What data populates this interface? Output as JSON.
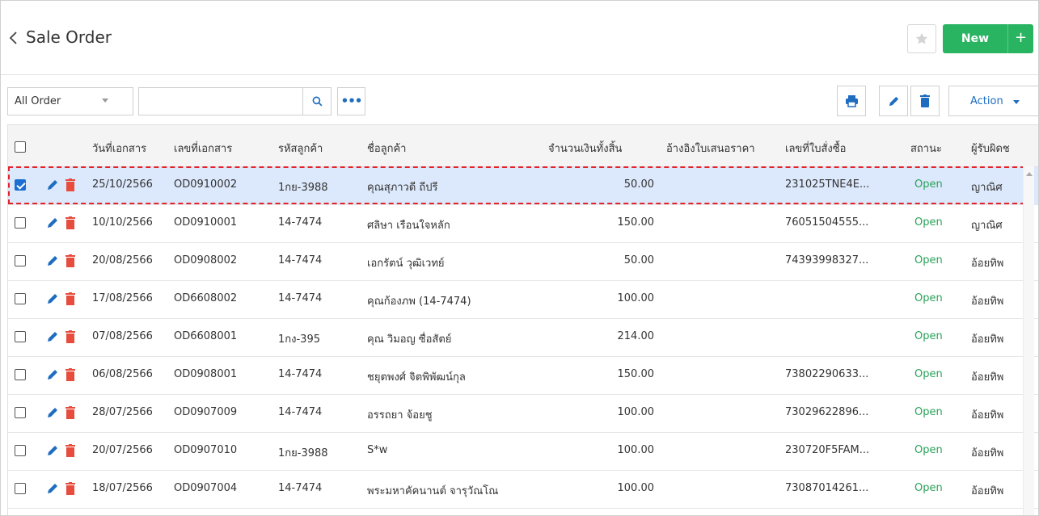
{
  "header": {
    "title": "Sale Order",
    "new_label": "New",
    "plus_label": "+"
  },
  "toolbar": {
    "filter_value": "All Order",
    "search_placeholder": "",
    "more_label": "•••",
    "action_label": "Action"
  },
  "colors": {
    "accent_green": "#29b461",
    "accent_blue": "#1e6dc0",
    "delete_red": "#e74c3c",
    "status_green": "#2aa35a",
    "highlight_red": "#e1242b",
    "selected_row": "#dce8fb"
  },
  "table": {
    "columns": [
      "วันที่เอกสาร",
      "เลขที่เอกสาร",
      "รหัสลูกค้า",
      "ชื่อลูกค้า",
      "จำนวนเงินทั้งสิ้น",
      "อ้างอิงใบเสนอราคา",
      "เลขที่ใบสั่งซื้อ",
      "สถานะ",
      "ผู้รับผิดช"
    ],
    "rows": [
      {
        "date": "25/10/2566",
        "doc_no": "OD0910002",
        "cust_code": "1กย-3988",
        "cust_name": "คุณสุภาวดี ถีปรี",
        "amount": "50.00",
        "quotation_ref": "",
        "po_no": "231025TNE4E...",
        "status": "Open",
        "owner": "ญาณิศ",
        "selected": true
      },
      {
        "date": "10/10/2566",
        "doc_no": "OD0910001",
        "cust_code": "14-7474",
        "cust_name": "ศลิษา เรือนใจหลัก",
        "amount": "150.00",
        "quotation_ref": "",
        "po_no": "76051504555...",
        "status": "Open",
        "owner": "ญาณิศ",
        "selected": false
      },
      {
        "date": "20/08/2566",
        "doc_no": "OD0908002",
        "cust_code": "14-7474",
        "cust_name": "เอกรัตน์ วุฒิเวทย์",
        "amount": "50.00",
        "quotation_ref": "",
        "po_no": "74393998327...",
        "status": "Open",
        "owner": "อ้อยทิพ",
        "selected": false
      },
      {
        "date": "17/08/2566",
        "doc_no": "OD6608002",
        "cust_code": "14-7474",
        "cust_name": "คุณก้องภพ (14-7474)",
        "amount": "100.00",
        "quotation_ref": "",
        "po_no": "",
        "status": "Open",
        "owner": "อ้อยทิพ",
        "selected": false
      },
      {
        "date": "07/08/2566",
        "doc_no": "OD6608001",
        "cust_code": "1กง-395",
        "cust_name": "คุณ วิมอญ ซื่อสัตย์",
        "amount": "214.00",
        "quotation_ref": "",
        "po_no": "",
        "status": "Open",
        "owner": "อ้อยทิพ",
        "selected": false
      },
      {
        "date": "06/08/2566",
        "doc_no": "OD0908001",
        "cust_code": "14-7474",
        "cust_name": "ชยุตพงศ์ จิตพิพัฒน์กุล",
        "amount": "150.00",
        "quotation_ref": "",
        "po_no": "73802290633...",
        "status": "Open",
        "owner": "อ้อยทิพ",
        "selected": false
      },
      {
        "date": "28/07/2566",
        "doc_no": "OD0907009",
        "cust_code": "14-7474",
        "cust_name": "อรรถยา จ้อยชู",
        "amount": "100.00",
        "quotation_ref": "",
        "po_no": "73029622896...",
        "status": "Open",
        "owner": "อ้อยทิพ",
        "selected": false
      },
      {
        "date": "20/07/2566",
        "doc_no": "OD0907010",
        "cust_code": "1กย-3988",
        "cust_name": "S*w",
        "amount": "100.00",
        "quotation_ref": "",
        "po_no": "230720F5FAM...",
        "status": "Open",
        "owner": "อ้อยทิพ",
        "selected": false
      },
      {
        "date": "18/07/2566",
        "doc_no": "OD0907004",
        "cust_code": "14-7474",
        "cust_name": "พระมหาคัคนานต์ จารุวัณโณ",
        "amount": "100.00",
        "quotation_ref": "",
        "po_no": "73087014261...",
        "status": "Open",
        "owner": "อ้อยทิพ",
        "selected": false
      }
    ]
  }
}
